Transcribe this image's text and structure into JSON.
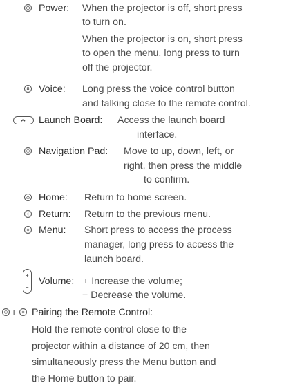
{
  "items": {
    "power": {
      "label": "Power:",
      "lines": [
        "When the projector is off, short press",
        "to turn on.",
        "When the projector is on, short press",
        "to open the menu, long press to turn",
        "off the projector."
      ]
    },
    "voice": {
      "label": "Voice:",
      "lines": [
        "Long press the voice control button",
        "and talking close to the remote control."
      ]
    },
    "launch_board": {
      "label": "Launch Board:",
      "lines": [
        "Access the launch board",
        "interface."
      ]
    },
    "navigation_pad": {
      "label": "Navigation Pad:",
      "lines": [
        "Move to up, down, left, or",
        "right, then press the middle",
        "to confirm."
      ]
    },
    "home": {
      "label": "Home:",
      "lines": [
        "Return to home screen."
      ]
    },
    "return": {
      "label": "Return:",
      "lines": [
        "Return to the previous menu."
      ]
    },
    "menu": {
      "label": "Menu:",
      "lines": [
        "Short press to access the process",
        "manager, long press to access the",
        "launch board."
      ]
    },
    "volume": {
      "label": "Volume:",
      "lines": [
        "+ Increase the volume;",
        "− Decrease the volume."
      ]
    },
    "pairing": {
      "combo": "+",
      "label": "Pairing the Remote Control:",
      "lines": [
        "Hold the remote control close to the",
        "projector within a distance of 20 cm, then",
        "simultaneously press the Menu button and",
        "the Home button to pair."
      ]
    }
  },
  "icons": {
    "power": "power-icon",
    "voice": "microphone-icon",
    "launch_board": "launch-board-button-icon",
    "navigation_pad": "navigation-pad-icon",
    "home": "home-icon",
    "return": "return-icon",
    "menu": "menu-icon",
    "volume": "volume-rocker-icon"
  }
}
